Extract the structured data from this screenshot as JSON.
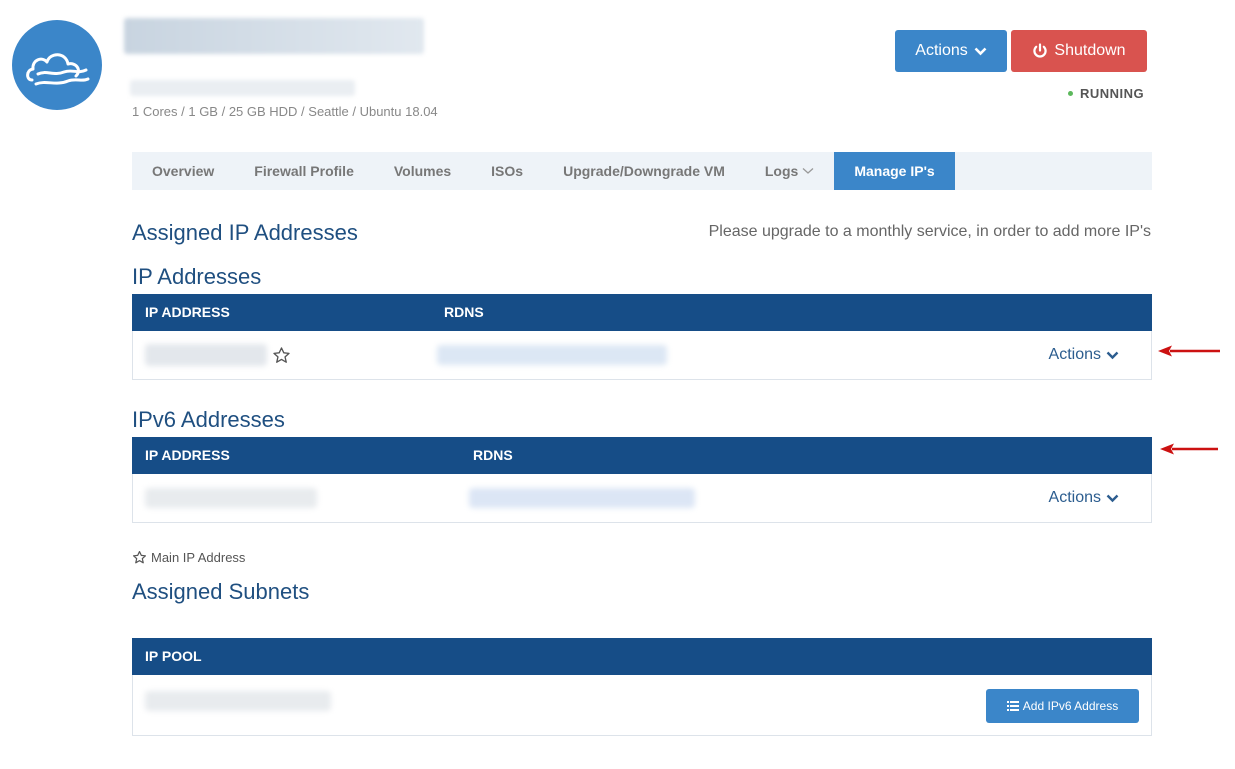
{
  "server": {
    "specs": "1 Cores / 1 GB / 25 GB HDD / Seattle / Ubuntu 18.04",
    "status": "RUNNING"
  },
  "header_buttons": {
    "actions_label": "Actions",
    "shutdown_label": "Shutdown"
  },
  "tabs": [
    {
      "label": "Overview"
    },
    {
      "label": "Firewall Profile"
    },
    {
      "label": "Volumes"
    },
    {
      "label": "ISOs"
    },
    {
      "label": "Upgrade/Downgrade VM"
    },
    {
      "label": "Logs"
    },
    {
      "label": "Manage IP's"
    }
  ],
  "assigned_ip": {
    "title": "Assigned IP Addresses",
    "notice": "Please upgrade to a monthly service, in order to add more IP's"
  },
  "ipv4": {
    "title": "IP Addresses",
    "col_ip": "IP ADDRESS",
    "col_rdns": "RDNS",
    "row_actions": "Actions"
  },
  "ipv6": {
    "title": "IPv6 Addresses",
    "col_ip": "IP ADDRESS",
    "col_rdns": "RDNS",
    "row_actions": "Actions"
  },
  "legend": {
    "main_ip": "Main IP Address"
  },
  "subnets": {
    "title": "Assigned Subnets",
    "col_pool": "IP POOL",
    "add_button": "Add IPv6 Address"
  },
  "colors": {
    "primary": "#3b86c9",
    "danger": "#d9534f",
    "table_header": "#164d87",
    "title": "#1f4f80",
    "success": "#5cb85c"
  },
  "icons": [
    "cloud-logo-icon",
    "chevron-down-icon",
    "power-icon",
    "star-outline-icon",
    "list-icon",
    "red-arrow-left-icon"
  ]
}
